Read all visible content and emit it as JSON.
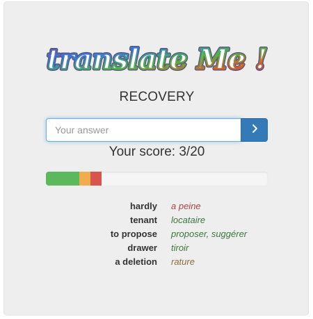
{
  "app": {
    "logo_text": "translate Me !",
    "mode": "RECOVERY"
  },
  "answer": {
    "placeholder": "Your answer",
    "value": ""
  },
  "score": {
    "text": "Your score: 3/20"
  },
  "progress": {
    "segments": [
      {
        "name": "correct",
        "percent": 15,
        "color": "#5cb85c"
      },
      {
        "name": "partial",
        "percent": 5,
        "color": "#f0ad4e"
      },
      {
        "name": "wrong",
        "percent": 5,
        "color": "#d9534f"
      }
    ]
  },
  "words": [
    {
      "source": "hardly",
      "translation": "a peine",
      "color": "#a94442"
    },
    {
      "source": "tenant",
      "translation": "locataire",
      "color": "#3c763d"
    },
    {
      "source": "to propose",
      "translation": "proposer, suggérer",
      "color": "#3c763d"
    },
    {
      "source": "drawer",
      "translation": "tiroir",
      "color": "#3c763d"
    },
    {
      "source": "a deletion",
      "translation": "rature",
      "color": "#8a6d3b"
    }
  ],
  "icons": {
    "submit": "chevron-right-icon"
  }
}
